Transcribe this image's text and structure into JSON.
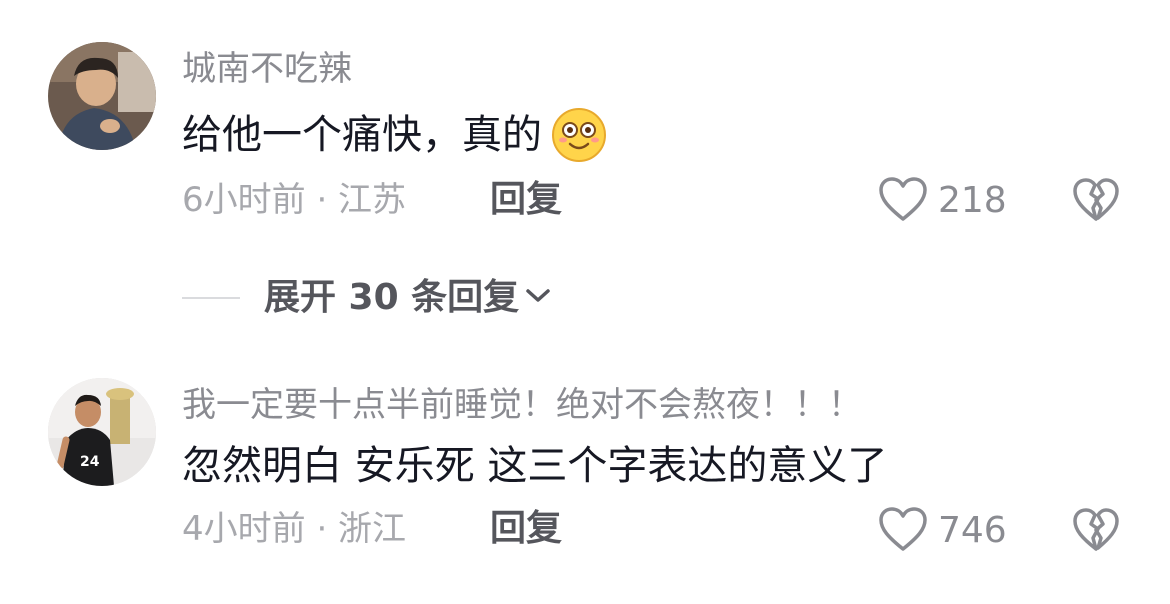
{
  "comments": [
    {
      "username": "城南不吃辣",
      "content": "给他一个痛快，真的",
      "emoji_icon": "blushing-smile-emoji-icon",
      "time_location": "6小时前 · 江苏",
      "reply_label": "回复",
      "like_count": "218"
    },
    {
      "username": "我一定要十点半前睡觉！绝对不会熬夜！！！",
      "content": "忽然明白 安乐死 这三个字表达的意义了",
      "time_location": "4小时前 · 浙江",
      "reply_label": "回复",
      "like_count": "746"
    }
  ],
  "expand_replies": {
    "label": "展开 30 条回复"
  },
  "colors": {
    "username": "#8a8b91",
    "content": "#161823",
    "meta": "#a7a8ad",
    "action": "#55565c",
    "emoji": "#ffd44a"
  }
}
